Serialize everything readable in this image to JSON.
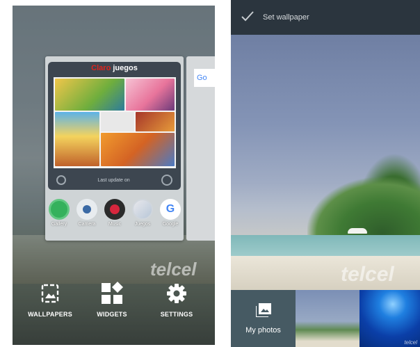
{
  "left_screen": {
    "widget": {
      "title_brand": "Claro",
      "title_text": "juegos",
      "footer_text": "Last update on"
    },
    "apps": [
      {
        "label": "Gallery"
      },
      {
        "label": "Camera"
      },
      {
        "label": "Music"
      },
      {
        "label": "Juegos"
      },
      {
        "label": "Google"
      }
    ],
    "next_card_text": "Go",
    "watermark": "telcel",
    "menu": {
      "wallpapers": "WALLPAPERS",
      "widgets": "WIDGETS",
      "settings": "SETTINGS"
    }
  },
  "right_screen": {
    "top_bar": {
      "title": "Set wallpaper"
    },
    "watermark": "telcel",
    "thumbnails": {
      "my_photos": "My photos",
      "corner_mark": "telcel"
    }
  },
  "colors": {
    "brand_red": "#e0231c",
    "google_blue": "#4285f4",
    "toolbar_dark": "#2b353e"
  }
}
